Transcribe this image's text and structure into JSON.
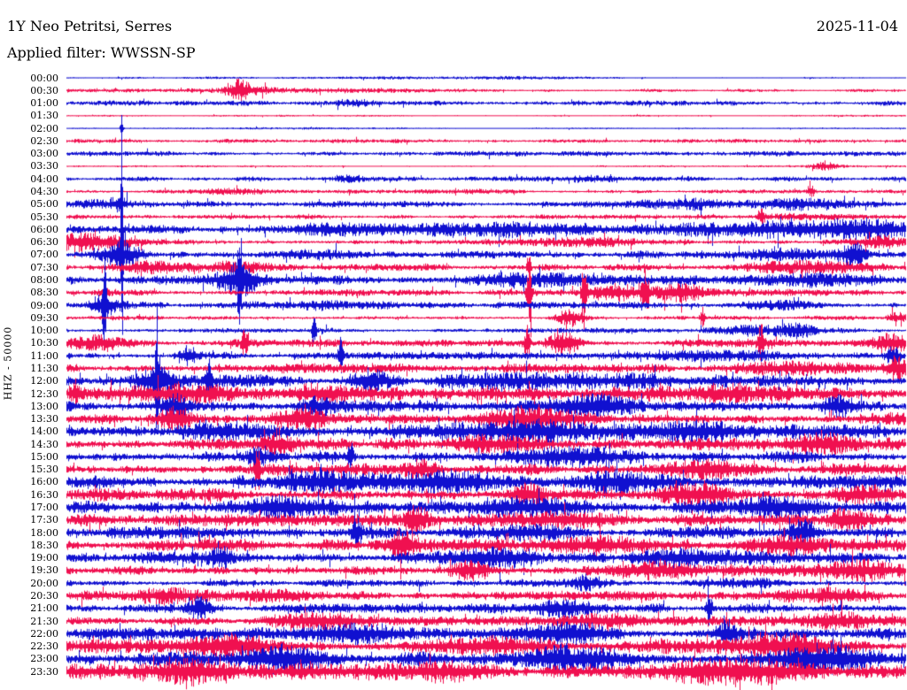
{
  "header": {
    "title": "1Y Neo Petritsi, Serres",
    "date": "2025-11-04",
    "filter_label": "Applied filter: WWSSN-SP"
  },
  "y_axis_label": "HHZ - 50000",
  "colors": {
    "trace_blue": "#1010d0",
    "trace_red": "#f01050",
    "background": "#ffffff",
    "text": "#000000"
  },
  "chart_data": {
    "type": "line",
    "subtype": "helicorder-dayplot",
    "station": "1Y Neo Petritsi, Serres",
    "channel_scale_label": "HHZ - 50000",
    "date": "2025-11-04",
    "filter": "WWSSN-SP",
    "minutes_per_row": 30,
    "legend_position": "none",
    "grid": false,
    "note": "48 half-hour traces, alternating blue (:00) and red (:30); base = typical half-amplitude in px, bursts = [position 0-1, width 0-1, extra amplitude px]",
    "rows": [
      {
        "label": "00:00",
        "color": "blue",
        "base": 0.8,
        "bursts": [
          [
            0.16,
            0.02,
            0.8
          ],
          [
            0.42,
            0.06,
            0.7
          ],
          [
            0.55,
            0.04,
            0.8
          ]
        ]
      },
      {
        "label": "00:30",
        "color": "red",
        "base": 1.3,
        "bursts": [
          [
            0.05,
            0.1,
            0.8
          ],
          [
            0.206,
            0.008,
            8.5
          ],
          [
            0.225,
            0.025,
            3
          ],
          [
            0.35,
            0.05,
            0.8
          ]
        ]
      },
      {
        "label": "01:00",
        "color": "blue",
        "base": 1.9,
        "bursts": [
          [
            0.345,
            0.012,
            2.2
          ]
        ]
      },
      {
        "label": "01:30",
        "color": "red",
        "base": 0.7,
        "bursts": []
      },
      {
        "label": "02:00",
        "color": "blue",
        "base": 0.55,
        "bursts": [
          [
            0.0655,
            0.0012,
            13
          ],
          [
            0.3,
            0.1,
            0.5
          ]
        ]
      },
      {
        "label": "02:30",
        "color": "red",
        "base": 1.5,
        "bursts": []
      },
      {
        "label": "03:00",
        "color": "blue",
        "base": 1.9,
        "bursts": []
      },
      {
        "label": "03:30",
        "color": "red",
        "base": 0.75,
        "bursts": [
          [
            0.905,
            0.012,
            4
          ]
        ]
      },
      {
        "label": "04:00",
        "color": "blue",
        "base": 1.9,
        "bursts": [
          [
            0.34,
            0.012,
            2.2
          ],
          [
            0.62,
            0.02,
            1.6
          ]
        ]
      },
      {
        "label": "04:30",
        "color": "red",
        "base": 1.4,
        "bursts": [
          [
            0.2,
            0.04,
            1.8
          ],
          [
            0.47,
            0.04,
            1.5
          ],
          [
            0.888,
            0.003,
            5
          ]
        ]
      },
      {
        "label": "05:00",
        "color": "blue",
        "base": 2.3,
        "bursts": [
          [
            0.03,
            0.025,
            3
          ],
          [
            0.062,
            0.007,
            5
          ],
          [
            0.73,
            0.05,
            4
          ],
          [
            0.87,
            0.04,
            5
          ]
        ]
      },
      {
        "label": "05:30",
        "color": "red",
        "base": 1.7,
        "bursts": [
          [
            0.828,
            0.003,
            8
          ],
          [
            0.87,
            0.04,
            2.5
          ]
        ]
      },
      {
        "label": "06:00",
        "color": "blue",
        "base": 3.6,
        "bursts": [
          [
            0.35,
            0.07,
            4
          ],
          [
            0.55,
            0.05,
            4
          ],
          [
            0.8,
            0.09,
            5
          ],
          [
            0.95,
            0.04,
            6
          ]
        ]
      },
      {
        "label": "06:30",
        "color": "red",
        "base": 2.1,
        "bursts": [
          [
            0.012,
            0.015,
            7
          ],
          [
            0.05,
            0.025,
            5
          ],
          [
            0.62,
            0.05,
            3
          ],
          [
            0.97,
            0.025,
            6
          ]
        ]
      },
      {
        "label": "07:00",
        "color": "blue",
        "base": 3.1,
        "bursts": [
          [
            0.0655,
            0.0009,
            150
          ],
          [
            0.0655,
            0.018,
            12
          ],
          [
            0.3,
            0.04,
            4
          ],
          [
            0.85,
            0.04,
            5
          ],
          [
            0.937,
            0.008,
            12
          ]
        ]
      },
      {
        "label": "07:30",
        "color": "red",
        "base": 2.6,
        "bursts": [
          [
            0.1,
            0.035,
            5
          ],
          [
            0.2,
            0.025,
            4
          ],
          [
            0.551,
            0.0015,
            18
          ],
          [
            0.88,
            0.05,
            4
          ]
        ]
      },
      {
        "label": "08:00",
        "color": "blue",
        "base": 3.6,
        "bursts": [
          [
            0.206,
            0.0015,
            62
          ],
          [
            0.206,
            0.018,
            14
          ],
          [
            0.55,
            0.04,
            5
          ],
          [
            0.9,
            0.04,
            5
          ]
        ]
      },
      {
        "label": "08:30",
        "color": "red",
        "base": 2.6,
        "bursts": [
          [
            0.551,
            0.002,
            42
          ],
          [
            0.617,
            0.002,
            38
          ],
          [
            0.648,
            0.025,
            8
          ],
          [
            0.69,
            0.003,
            24
          ],
          [
            0.73,
            0.018,
            8
          ]
        ]
      },
      {
        "label": "09:00",
        "color": "blue",
        "base": 2.6,
        "bursts": [
          [
            0.045,
            0.0015,
            42
          ],
          [
            0.045,
            0.012,
            10
          ],
          [
            0.3,
            0.04,
            3
          ],
          [
            0.85,
            0.035,
            4
          ]
        ]
      },
      {
        "label": "09:30",
        "color": "red",
        "base": 1.7,
        "bursts": [
          [
            0.6,
            0.012,
            8
          ],
          [
            0.758,
            0.002,
            10
          ],
          [
            0.99,
            0.008,
            6
          ]
        ]
      },
      {
        "label": "10:00",
        "color": "blue",
        "base": 1.9,
        "bursts": [
          [
            0.295,
            0.002,
            18
          ],
          [
            0.82,
            0.035,
            5
          ],
          [
            0.872,
            0.015,
            6
          ]
        ]
      },
      {
        "label": "10:30",
        "color": "red",
        "base": 2.9,
        "bursts": [
          [
            0.03,
            0.025,
            6
          ],
          [
            0.213,
            0.003,
            14
          ],
          [
            0.549,
            0.002,
            22
          ],
          [
            0.594,
            0.012,
            12
          ],
          [
            0.828,
            0.003,
            18
          ],
          [
            0.985,
            0.015,
            8
          ]
        ]
      },
      {
        "label": "11:00",
        "color": "blue",
        "base": 2.9,
        "bursts": [
          [
            0.145,
            0.008,
            9
          ],
          [
            0.327,
            0.002,
            28
          ],
          [
            0.76,
            0.07,
            4
          ],
          [
            0.985,
            0.006,
            10
          ]
        ]
      },
      {
        "label": "11:30",
        "color": "red",
        "base": 3.6,
        "bursts": [
          [
            0.85,
            0.04,
            6
          ],
          [
            0.99,
            0.008,
            10
          ]
        ]
      },
      {
        "label": "12:00",
        "color": "blue",
        "base": 4.6,
        "bursts": [
          [
            0.108,
            0.0015,
            62
          ],
          [
            0.108,
            0.012,
            12
          ],
          [
            0.17,
            0.002,
            32
          ],
          [
            0.36,
            0.015,
            10
          ],
          [
            0.6,
            0.09,
            4
          ]
        ]
      },
      {
        "label": "12:30",
        "color": "red",
        "base": 5.0,
        "bursts": [
          [
            0.011,
            0.004,
            10
          ],
          [
            0.15,
            0.04,
            7
          ],
          [
            0.3,
            0.025,
            7
          ],
          [
            0.8,
            0.09,
            5
          ]
        ]
      },
      {
        "label": "13:00",
        "color": "blue",
        "base": 5.0,
        "bursts": [
          [
            0.13,
            0.015,
            10
          ],
          [
            0.3,
            0.015,
            9
          ],
          [
            0.63,
            0.025,
            8
          ],
          [
            0.92,
            0.015,
            10
          ]
        ]
      },
      {
        "label": "13:30",
        "color": "red",
        "base": 5.0,
        "bursts": [
          [
            0.13,
            0.015,
            11
          ],
          [
            0.28,
            0.025,
            9
          ],
          [
            0.55,
            0.04,
            7
          ]
        ]
      },
      {
        "label": "14:00",
        "color": "blue",
        "base": 5.5,
        "bursts": [
          [
            0.2,
            0.04,
            7
          ],
          [
            0.55,
            0.05,
            9
          ],
          [
            0.75,
            0.04,
            7
          ]
        ]
      },
      {
        "label": "14:30",
        "color": "red",
        "base": 4.6,
        "bursts": [
          [
            0.25,
            0.015,
            8
          ],
          [
            0.5,
            0.035,
            7
          ],
          [
            0.9,
            0.035,
            7
          ]
        ]
      },
      {
        "label": "15:00",
        "color": "blue",
        "base": 4.6,
        "bursts": [
          [
            0.227,
            0.008,
            8
          ],
          [
            0.338,
            0.002,
            16
          ],
          [
            0.6,
            0.04,
            6
          ]
        ]
      },
      {
        "label": "15:30",
        "color": "red",
        "base": 4.6,
        "bursts": [
          [
            0.227,
            0.002,
            30
          ],
          [
            0.42,
            0.015,
            8
          ],
          [
            0.75,
            0.035,
            7
          ]
        ]
      },
      {
        "label": "16:00",
        "color": "blue",
        "base": 5.0,
        "bursts": [
          [
            0.3,
            0.035,
            7
          ],
          [
            0.45,
            0.05,
            8
          ],
          [
            0.65,
            0.035,
            7
          ]
        ]
      },
      {
        "label": "16:30",
        "color": "red",
        "base": 5.0,
        "bursts": [
          [
            0.55,
            0.015,
            10
          ],
          [
            0.75,
            0.025,
            8
          ],
          [
            0.95,
            0.025,
            8
          ]
        ]
      },
      {
        "label": "17:00",
        "color": "blue",
        "base": 5.0,
        "bursts": [
          [
            0.25,
            0.04,
            7
          ],
          [
            0.55,
            0.04,
            7
          ],
          [
            0.85,
            0.035,
            7
          ]
        ]
      },
      {
        "label": "17:30",
        "color": "red",
        "base": 4.6,
        "bursts": [
          [
            0.417,
            0.008,
            13
          ],
          [
            0.6,
            0.04,
            6
          ],
          [
            0.93,
            0.015,
            8
          ]
        ]
      },
      {
        "label": "18:00",
        "color": "blue",
        "base": 4.6,
        "bursts": [
          [
            0.345,
            0.004,
            14
          ],
          [
            0.55,
            0.025,
            7
          ],
          [
            0.877,
            0.01,
            12
          ]
        ]
      },
      {
        "label": "18:30",
        "color": "red",
        "base": 4.6,
        "bursts": [
          [
            0.4,
            0.01,
            13
          ],
          [
            0.65,
            0.04,
            6
          ],
          [
            0.85,
            0.035,
            6
          ]
        ]
      },
      {
        "label": "19:00",
        "color": "blue",
        "base": 4.6,
        "bursts": [
          [
            0.185,
            0.01,
            11
          ],
          [
            0.5,
            0.035,
            7
          ],
          [
            0.75,
            0.04,
            6
          ]
        ]
      },
      {
        "label": "19:30",
        "color": "red",
        "base": 4.6,
        "bursts": [
          [
            0.48,
            0.015,
            9
          ],
          [
            0.7,
            0.05,
            6
          ],
          [
            0.95,
            0.025,
            7
          ]
        ]
      },
      {
        "label": "20:00",
        "color": "blue",
        "base": 2.9,
        "bursts": [
          [
            0.62,
            0.012,
            6
          ],
          [
            0.8,
            0.04,
            4
          ]
        ]
      },
      {
        "label": "20:30",
        "color": "red",
        "base": 3.6,
        "bursts": [
          [
            0.12,
            0.035,
            7
          ],
          [
            0.25,
            0.025,
            6
          ],
          [
            0.9,
            0.035,
            5
          ]
        ]
      },
      {
        "label": "21:00",
        "color": "blue",
        "base": 3.6,
        "bursts": [
          [
            0.158,
            0.01,
            10
          ],
          [
            0.59,
            0.025,
            6
          ],
          [
            0.766,
            0.002,
            24
          ]
        ]
      },
      {
        "label": "21:30",
        "color": "red",
        "base": 3.6,
        "bursts": [
          [
            0.3,
            0.04,
            5
          ],
          [
            0.65,
            0.035,
            6
          ],
          [
            0.92,
            0.025,
            6
          ]
        ]
      },
      {
        "label": "22:00",
        "color": "blue",
        "base": 4.6,
        "bursts": [
          [
            0.35,
            0.035,
            6
          ],
          [
            0.6,
            0.035,
            7
          ],
          [
            0.787,
            0.01,
            13
          ]
        ]
      },
      {
        "label": "22:30",
        "color": "red",
        "base": 5.5,
        "bursts": [
          [
            0.2,
            0.04,
            7
          ],
          [
            0.5,
            0.05,
            7
          ],
          [
            0.85,
            0.04,
            8
          ]
        ]
      },
      {
        "label": "23:00",
        "color": "blue",
        "base": 6.0,
        "bursts": [
          [
            0.25,
            0.035,
            8
          ],
          [
            0.6,
            0.05,
            8
          ],
          [
            0.9,
            0.035,
            9
          ]
        ]
      },
      {
        "label": "23:30",
        "color": "red",
        "base": 6.0,
        "bursts": [
          [
            0.15,
            0.04,
            8
          ],
          [
            0.45,
            0.04,
            8
          ],
          [
            0.8,
            0.05,
            9
          ]
        ]
      }
    ]
  }
}
